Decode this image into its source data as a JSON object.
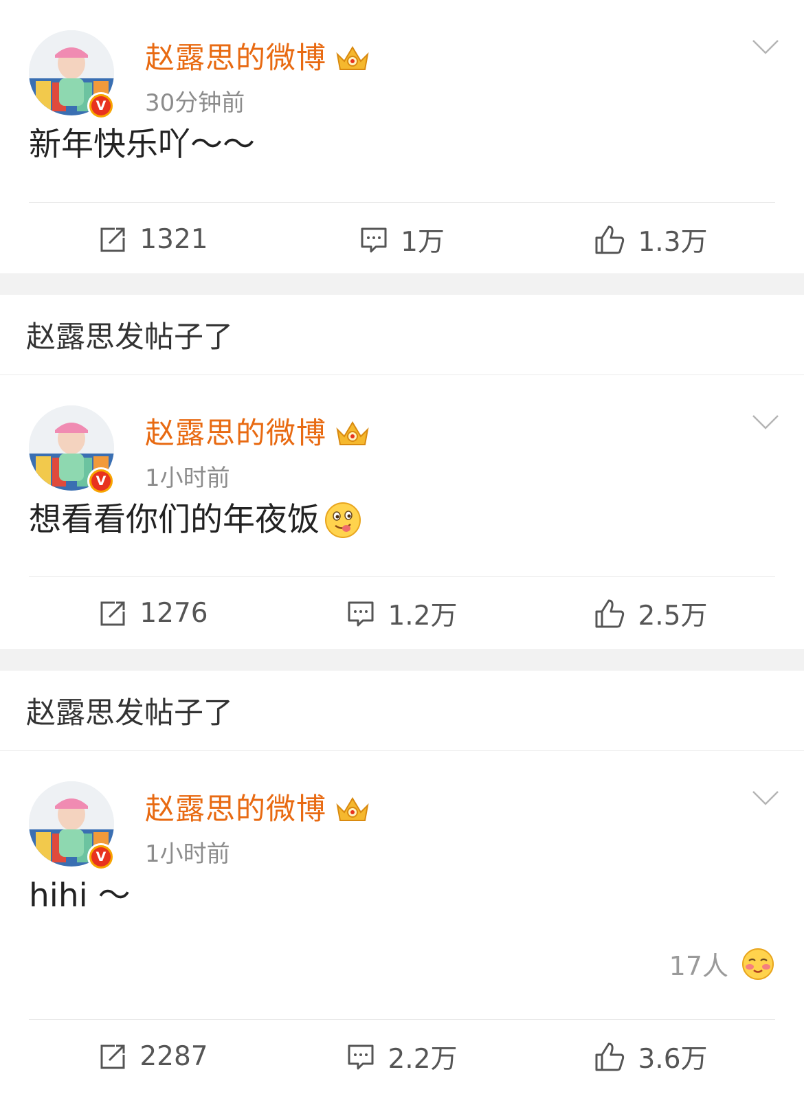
{
  "posts": [
    {
      "author": "赵露思的微博",
      "time": "30分钟前",
      "text": "新年快乐吖～～",
      "emoji": "",
      "reposts": "1321",
      "comments": "1万",
      "likes": "1.3万"
    },
    {
      "section_title": "赵露思发帖子了",
      "author": "赵露思的微博",
      "time": "1小时前",
      "text": "想看看你们的年夜饭",
      "emoji": "yum-face-emoji",
      "reposts": "1276",
      "comments": "1.2万",
      "likes": "2.5万"
    },
    {
      "section_title": "赵露思发帖子了",
      "author": "赵露思的微博",
      "time": "1小时前",
      "text": "hihi ～",
      "reaction_count": "17人",
      "reaction_emoji": "blushing-face-emoji",
      "reposts": "2287",
      "comments": "2.2万",
      "likes": "3.6万"
    }
  ],
  "colors": {
    "author_name": "#e86a12",
    "timestamp": "#8c8c8c",
    "divider": "#ececec",
    "verified_badge": "#e8321e"
  },
  "icons": {
    "repost": "repost-icon",
    "comment": "comment-icon",
    "like": "thumbs-up-icon",
    "more": "chevron-down-icon",
    "vip": "crown-icon",
    "verified": "verified-v-icon"
  }
}
